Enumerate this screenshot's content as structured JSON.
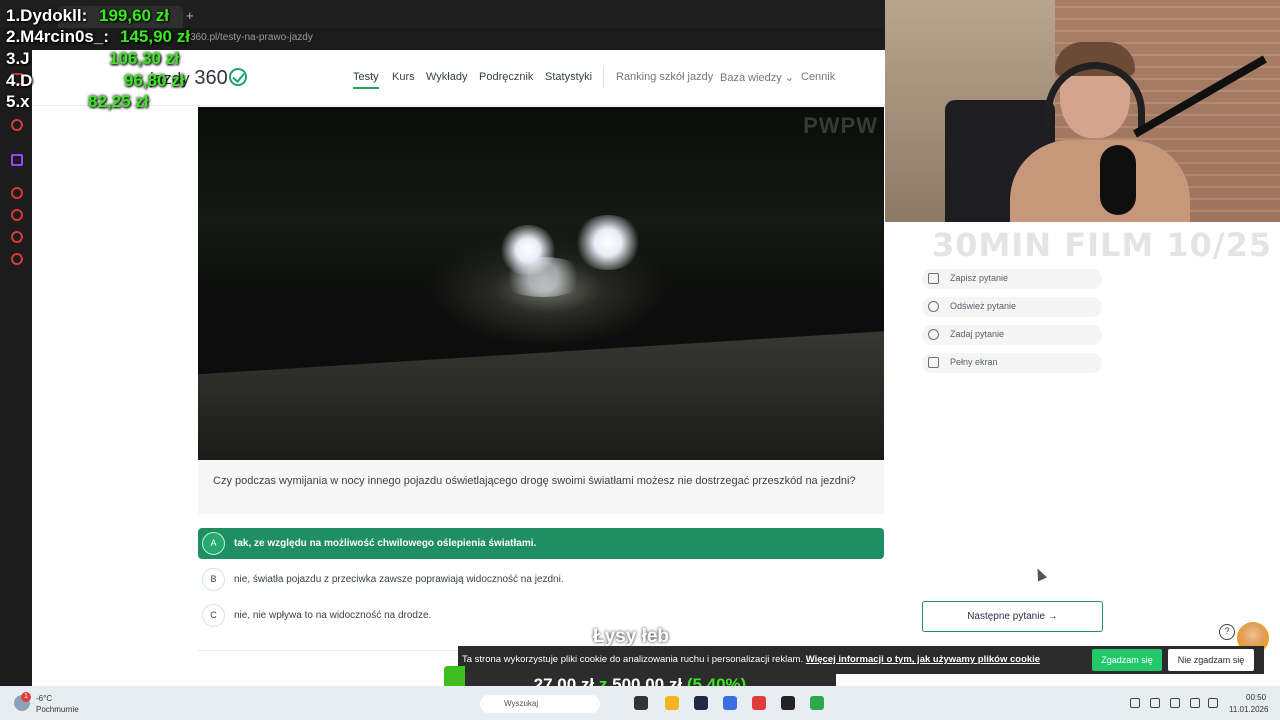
{
  "browser": {
    "address": "360.pl/testy-na-prawo-jazdy",
    "new_tab_symbol": "+"
  },
  "site": {
    "logo_text": "jazdy",
    "logo_suffix": "360",
    "nav": [
      {
        "label": "Testy",
        "active": true
      },
      {
        "label": "Kurs"
      },
      {
        "label": "Wykłady"
      },
      {
        "label": "Podręcznik"
      },
      {
        "label": "Statystyki"
      },
      {
        "label": "Ranking szkół jazdy"
      },
      {
        "label": "Baza wiedzy ⌄"
      },
      {
        "label": "Cennik"
      }
    ]
  },
  "video": {
    "watermark": "PWPW"
  },
  "question": {
    "text": "Czy podczas wymijania w nocy innego pojazdu oświetlającego drogę swoimi światłami możesz nie dostrzegać przeszkód na jezdni?",
    "answers": [
      {
        "letter": "A",
        "text": "tak, ze względu na możliwość chwilowego oślepienia światłami.",
        "selected": true
      },
      {
        "letter": "B",
        "text": "nie, światła pojazdu z przeciwka zawsze poprawiają widoczność na jezdni."
      },
      {
        "letter": "C",
        "text": "nie, nie wpływa to na widoczność na drodze."
      }
    ]
  },
  "panel": {
    "overlay_title": "30MIN FILM 10/25",
    "actions": [
      {
        "label": "Zapisz pytanie",
        "icon": "bookmark-icon"
      },
      {
        "label": "Odśwież pytanie",
        "icon": "refresh-icon"
      },
      {
        "label": "Zadaj pytanie",
        "icon": "chat-icon"
      },
      {
        "label": "Pełny ekran",
        "icon": "fullscreen-icon"
      }
    ],
    "next_button": "Następne pytanie →",
    "help_symbol": "?"
  },
  "leaderboard": [
    {
      "rank_name": "1.Dydokll:",
      "amount": "199,60 zł"
    },
    {
      "rank_name": "2.M4rcin0s_:",
      "amount": "145,90 zł"
    },
    {
      "rank_name": "3.J",
      "amount": "106,30 zł"
    },
    {
      "rank_name": "4.D",
      "amount": "96,80 zł"
    },
    {
      "rank_name": "5.x",
      "amount": "82,25 zł"
    }
  ],
  "stream": {
    "subtitle": "Łysy łeb",
    "goal_current": "27,00 zł",
    "goal_separator": "z",
    "goal_target": "500,00 zł",
    "goal_percent_label": "(5.40%)",
    "goal_progress": 0.054
  },
  "cookie": {
    "text": "Ta strona wykorzystuje pliki cookie do analizowania ruchu i personalizacji reklam.",
    "link": "Więcej informacji o tym, jak używamy plików cookie",
    "accept": "Zgadzam się",
    "reject": "Nie zgadzam się"
  },
  "taskbar": {
    "weather_badge": "1",
    "temperature": "-6°C",
    "weather": "Pochmurnie",
    "search": "Wyszukaj",
    "time": "00:50",
    "date": "11.01.2026"
  },
  "colors": {
    "accent": "#1f8e63",
    "goal_green": "#39e820"
  }
}
